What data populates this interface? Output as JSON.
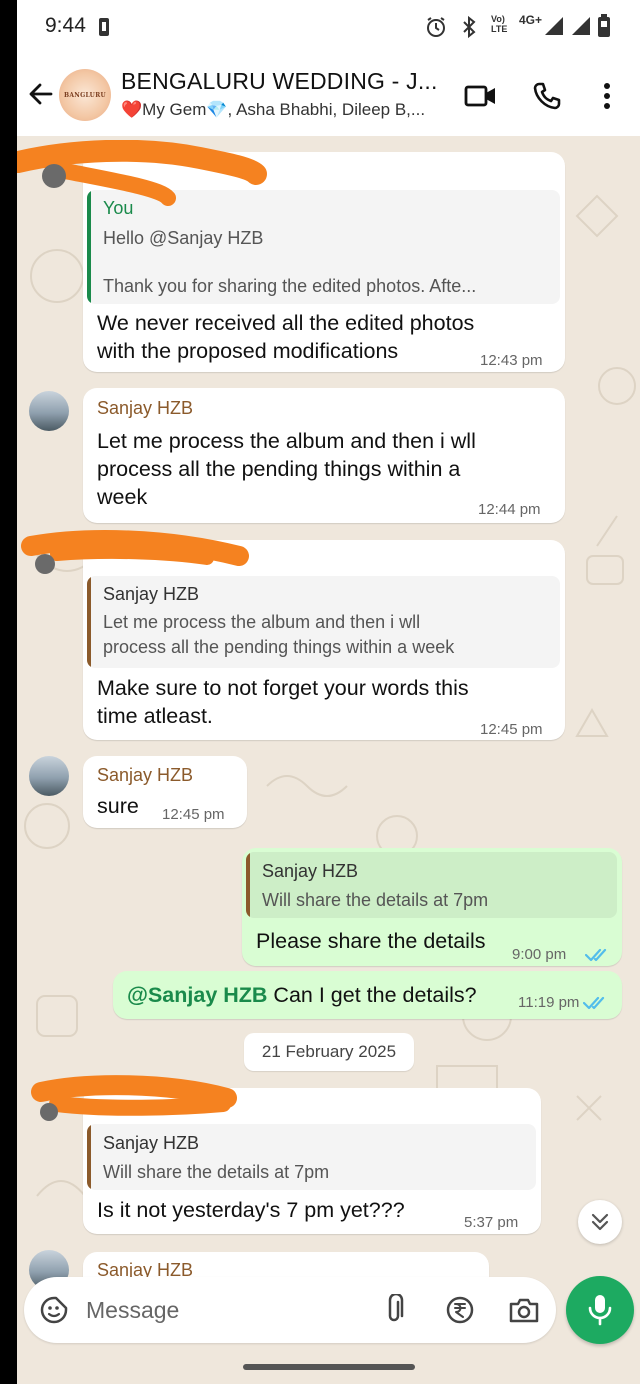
{
  "status_bar": {
    "time": "9:44",
    "network_label": "4G+",
    "volte_label": "Vo) LTE"
  },
  "header": {
    "title": "BENGALURU WEDDING - J...",
    "members": "❤️My Gem💎, Asha Bhabhi, Dileep B,...",
    "avatar_text": "BANGLURU",
    "icons": [
      "back-arrow-icon",
      "video-call-icon",
      "phone-call-icon",
      "more-options-icon"
    ]
  },
  "messages": [
    {
      "id": "m1",
      "direction": "incoming",
      "sender_hidden": true,
      "quote": {
        "name": "You",
        "text_lines": [
          "Hello @Sanjay HZB",
          "",
          "Thank you for sharing the edited photos. Afte..."
        ]
      },
      "text_lines": [
        "We never received all the edited photos",
        "with the proposed modifications"
      ],
      "time": "12:43 pm"
    },
    {
      "id": "m2",
      "direction": "incoming",
      "sender": "Sanjay HZB",
      "text_lines": [
        "Let me process the album and then i wll",
        "process all the pending things within a",
        "week"
      ],
      "time": "12:44 pm"
    },
    {
      "id": "m3",
      "direction": "incoming",
      "sender_hidden": true,
      "quote": {
        "name": "Sanjay HZB",
        "text_lines": [
          "Let me process the album and then i wll",
          "process all the pending things within a week"
        ]
      },
      "text_lines": [
        "Make sure to not forget your words this",
        "time atleast."
      ],
      "time": "12:45 pm"
    },
    {
      "id": "m4",
      "direction": "incoming",
      "sender": "Sanjay HZB",
      "text_lines": [
        "sure"
      ],
      "time": "12:45 pm"
    },
    {
      "id": "m5",
      "direction": "outgoing",
      "quote": {
        "name": "Sanjay HZB",
        "text_lines": [
          "Will share the details at 7pm"
        ]
      },
      "text_lines": [
        "Please share the details"
      ],
      "time": "9:00 pm",
      "read": true
    },
    {
      "id": "m6",
      "direction": "outgoing",
      "mention": "@Sanjay HZB",
      "text": " Can I get the details?",
      "time": "11:19 pm",
      "read": true
    },
    {
      "id": "m7",
      "direction": "incoming",
      "sender_hidden": true,
      "quote": {
        "name": "Sanjay HZB",
        "text_lines": [
          "Will share the details at 7pm"
        ]
      },
      "text_lines": [
        "Is it not yesterday's 7 pm yet???"
      ],
      "time": "5:37 pm"
    },
    {
      "id": "m8",
      "direction": "incoming",
      "sender": "Sanjay HZB",
      "partial": true
    }
  ],
  "date_separator": "21 February 2025",
  "composer": {
    "placeholder": "Message",
    "icons": [
      "sticker-icon",
      "attach-icon",
      "rupee-payment-icon",
      "camera-icon",
      "mic-icon"
    ]
  },
  "colors": {
    "chat_background": "#efe7dc",
    "outgoing_bubble": "#d9fdd3",
    "incoming_bubble": "#ffffff",
    "accent_green": "#1daa61",
    "read_ticks": "#53bdeb",
    "scribble": "#f58220",
    "sender_name": "#8b5a2b",
    "you_quote": "#1a8a4b"
  }
}
